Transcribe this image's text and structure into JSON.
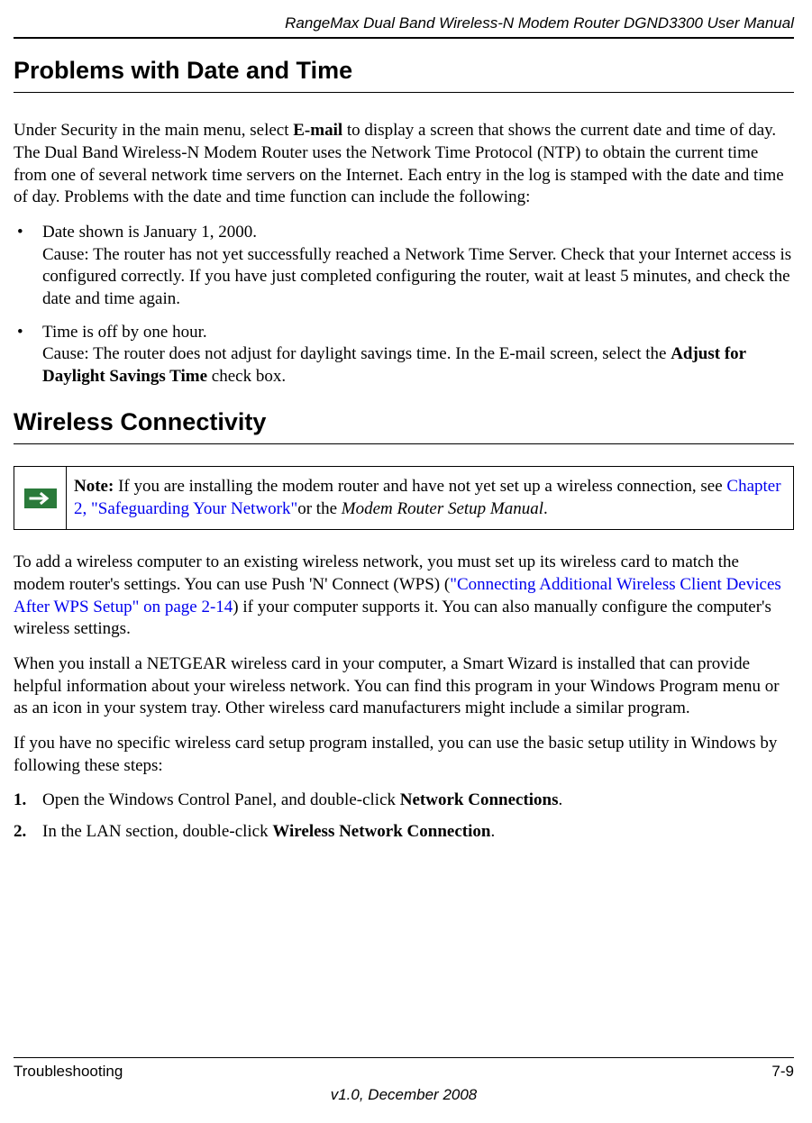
{
  "header": {
    "title": "RangeMax Dual Band Wireless-N Modem Router DGND3300 User Manual"
  },
  "section1": {
    "heading": "Problems with Date and Time",
    "intro_part1": "Under Security in the main menu, select ",
    "intro_bold1": "E-mail",
    "intro_part2": " to display a screen that shows the current date and time of day. The Dual Band Wireless-N Modem Router uses the Network Time Protocol (NTP) to obtain the current time from one of several network time servers on the Internet. Each entry in the log is stamped with the date and time of day. Problems with the date and time function can include the following:",
    "bullet1_line1": "Date shown is January 1, 2000.",
    "bullet1_line2": "Cause: The router has not yet successfully reached a Network Time Server. Check that your Internet access is configured correctly. If you have just completed configuring the router, wait at least 5 minutes, and check the date and time again.",
    "bullet2_line1": "Time is off by one hour.",
    "bullet2_line2_part1": "Cause: The router does not adjust for daylight savings time. In the E-mail screen, select the ",
    "bullet2_line2_bold": "Adjust for Daylight Savings Time",
    "bullet2_line2_part2": " check box."
  },
  "section2": {
    "heading": "Wireless Connectivity",
    "note_label": "Note:",
    "note_part1": " If you are installing the modem router and have not yet set up a wireless connection, see ",
    "note_link": "Chapter 2, \"Safeguarding Your Network\"",
    "note_part2": "or the ",
    "note_italic": "Modem Router Setup Manual",
    "note_part3": ".",
    "para1_part1": "To add a wireless computer to an existing wireless network, you must set up its wireless card to match the modem router's settings. You can use Push 'N' Connect (WPS) (",
    "para1_link": "\"Connecting Additional Wireless Client Devices After WPS Setup\" on page 2-14",
    "para1_part2": ") if your computer supports it. You can also manually configure the computer's wireless settings.",
    "para2": "When you install a NETGEAR wireless card in your computer, a Smart Wizard is installed that can provide helpful information about your wireless network. You can find this program in your Windows Program menu or as an icon in your system tray. Other wireless card manufacturers might include a similar program.",
    "para3": "If you have no specific wireless card setup program installed, you can use the basic setup utility in Windows by following these steps:",
    "step1_num": "1.",
    "step1_part1": "Open the Windows Control Panel, and double-click ",
    "step1_bold": "Network Connections",
    "step1_part2": ".",
    "step2_num": "2.",
    "step2_part1": "In the LAN section, double-click ",
    "step2_bold": "Wireless Network Connection",
    "step2_part2": "."
  },
  "footer": {
    "left": "Troubleshooting",
    "right": "7-9",
    "version": "v1.0, December 2008"
  }
}
